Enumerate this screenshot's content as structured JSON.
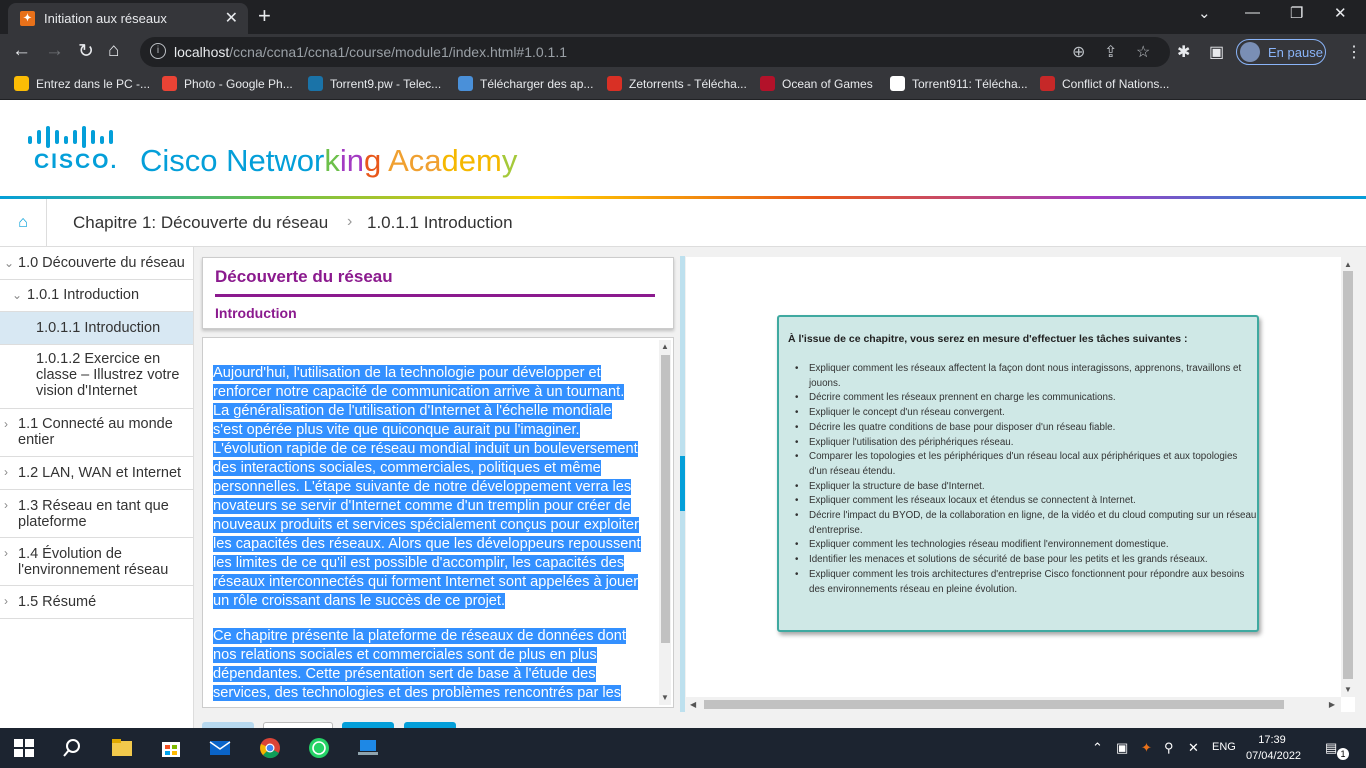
{
  "browser": {
    "tab_title": "Initiation aux réseaux",
    "url_host": "localhost",
    "url_path": "/ccna/ccna1/ccna1/course/module1/index.html#1.0.1.1",
    "profile_label": "En pause",
    "bookmarks": [
      {
        "label": "Entrez dans le PC -...",
        "icon": "google-icon",
        "color": "#fbbc05"
      },
      {
        "label": "Photo - Google Ph...",
        "icon": "google-photos-icon",
        "color": "#ea4335"
      },
      {
        "label": "Torrent9.pw - Telec...",
        "icon": "torrent9-icon",
        "color": "#1a73a8"
      },
      {
        "label": "Télécharger des ap...",
        "icon": "download-apps-icon",
        "color": "#4a90d9"
      },
      {
        "label": "Zetorrents - Télécha...",
        "icon": "zetorrents-icon",
        "color": "#d93025"
      },
      {
        "label": "Ocean of Games",
        "icon": "ocean-of-games-icon",
        "color": "#b3122a"
      },
      {
        "label": "Torrent911: Télécha...",
        "icon": "torrent911-icon",
        "color": "#ffffff"
      },
      {
        "label": "Conflict of Nations...",
        "icon": "conflict-of-nations-icon",
        "color": "#c62828"
      }
    ]
  },
  "header": {
    "logo_word": "CISCO.",
    "academy_parts": [
      {
        "text": "Cisco Networ",
        "color": "#049fd9"
      },
      {
        "text": "k",
        "color": "#6cc04a"
      },
      {
        "text": "in",
        "color": "#a33bc2"
      },
      {
        "text": "g ",
        "color": "#e8571a"
      },
      {
        "text": "Aca",
        "color": "#f0a030"
      },
      {
        "text": "dem",
        "color": "#f5b800"
      },
      {
        "text": "y",
        "color": "#a5c93a"
      }
    ]
  },
  "breadcrumb": {
    "chapter": "Chapitre 1: Découverte du réseau",
    "section": "1.0.1.1 Introduction"
  },
  "sidebar": {
    "items": [
      {
        "label": "1.0 Découverte du réseau",
        "expanded": true
      },
      {
        "label": "1.0.1 Introduction",
        "expanded": true
      },
      {
        "label": "1.0.1.1 Introduction",
        "active": true
      },
      {
        "label": "1.0.1.2 Exercice en classe – Illustrez votre vision d'Internet"
      },
      {
        "label": "1.1 Connecté au monde entier"
      },
      {
        "label": "1.2 LAN, WAN et Internet"
      },
      {
        "label": "1.3 Réseau en tant que plateforme"
      },
      {
        "label": "1.4 Évolution de l'environnement réseau"
      },
      {
        "label": "1.5 Résumé"
      }
    ]
  },
  "content": {
    "title": "Découverte du réseau",
    "subtitle": "Introduction",
    "paragraph1_lines": [
      "Aujourd'hui, l'utilisation de la technologie pour développer et",
      "renforcer notre capacité de communication arrive à un tournant.",
      "La généralisation de l'utilisation d'Internet à l'échelle mondiale",
      "s'est opérée plus vite que quiconque aurait pu l'imaginer.",
      "L'évolution rapide de ce réseau mondial induit un bouleversement",
      "des interactions sociales, commerciales, politiques et même",
      "personnelles. L'étape suivante de notre développement verra les",
      "novateurs se servir d'Internet comme d'un tremplin pour créer de",
      "nouveaux produits et services spécialement conçus pour exploiter",
      "les capacités des réseaux. Alors que les développeurs repoussent",
      "les limites de ce qu'il est possible d'accomplir, les capacités des",
      "réseaux interconnectés qui forment Internet sont appelées à jouer",
      "un rôle croissant dans le succès de ce projet."
    ],
    "paragraph2_lines": [
      "Ce chapitre présente la plateforme de réseaux de données dont",
      "nos relations sociales et commerciales sont de plus en plus",
      "dépendantes. Cette présentation sert de base à l'étude des",
      "services, des technologies et des problèmes rencontrés par les"
    ]
  },
  "objectives": {
    "title": "À l'issue de ce chapitre, vous serez en mesure d'effectuer les tâches suivantes :",
    "items": [
      "Expliquer comment les réseaux affectent la façon dont nous interagissons, apprenons, travaillons et jouons.",
      "Décrire comment les réseaux prennent en charge les communications.",
      "Expliquer le concept d'un réseau convergent.",
      "Décrire les quatre conditions de base pour disposer d'un réseau fiable.",
      "Expliquer l'utilisation des périphériques réseau.",
      "Comparer les topologies et les périphériques d'un réseau local aux périphériques et aux topologies d'un réseau étendu.",
      "Expliquer la structure de base d'Internet.",
      "Expliquer comment les réseaux locaux et étendus se connectent à Internet.",
      "Décrire l'impact du BYOD, de la collaboration en ligne, de la vidéo et du cloud computing sur un réseau d'entreprise.",
      "Expliquer comment les technologies réseau modifient l'environnement domestique.",
      "Identifier les menaces et solutions de sécurité de base pour les petits et les grands réseaux.",
      "Expliquer comment les trois architectures d'entreprise Cisco fonctionnent pour répondre aux besoins des environnements réseau en pleine évolution."
    ]
  },
  "taskbar": {
    "language": "ENG",
    "time": "17:39",
    "date": "07/04/2022",
    "notification_count": "1"
  }
}
